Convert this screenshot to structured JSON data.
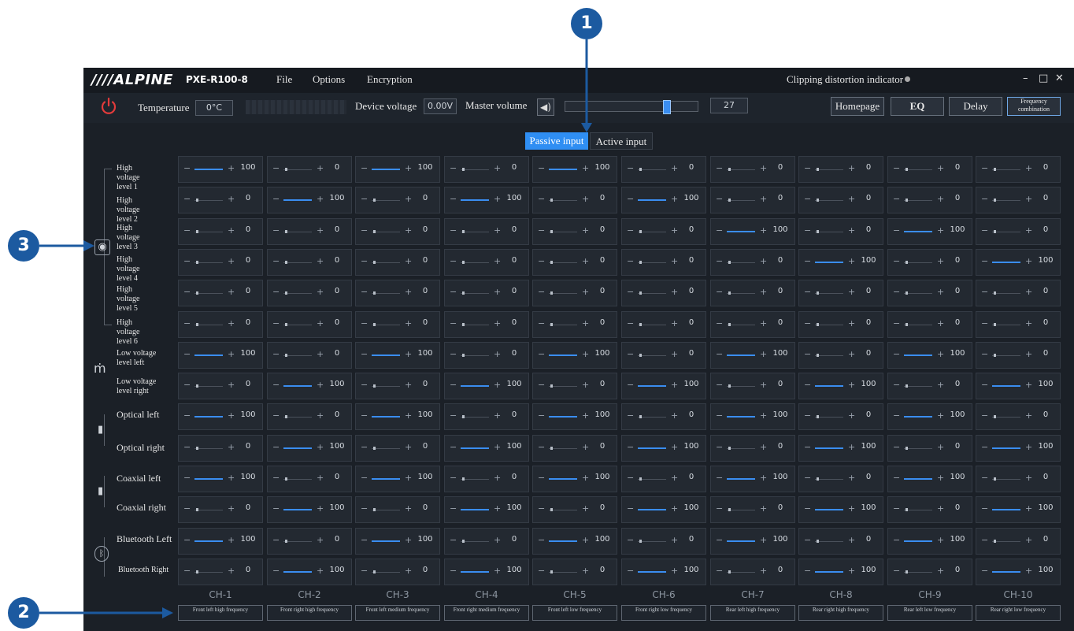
{
  "app": {
    "brand": "////ALPINE",
    "model": "PXE-R100-8",
    "menu": [
      "File",
      "Options",
      "Encryption"
    ],
    "clipping_indicator": "Clipping distortion indicator",
    "window_controls": [
      "–",
      "□",
      "✕"
    ]
  },
  "toolbar": {
    "temperature_label": "Temperature",
    "temperature_value": "0°C",
    "device_voltage_label": "Device voltage",
    "device_voltage_value": "0.00V",
    "master_volume_label": "Master volume",
    "master_volume_value": "27",
    "master_volume_fraction": 0.8,
    "nav": [
      "Homepage",
      "EQ",
      "Delay",
      "Frequency combination"
    ],
    "active_nav": "EQ"
  },
  "input_tabs": {
    "passive": "Passive input",
    "active": "Active input",
    "selected": "passive"
  },
  "rows": [
    {
      "label": "High voltage level 1",
      "values": [
        100,
        0,
        100,
        0,
        100,
        0,
        0,
        0,
        0,
        0
      ]
    },
    {
      "label": "High voltage level 2",
      "values": [
        0,
        100,
        0,
        100,
        0,
        100,
        0,
        0,
        0,
        0
      ]
    },
    {
      "label": "High voltage level 3",
      "values": [
        0,
        0,
        0,
        0,
        0,
        0,
        100,
        0,
        100,
        0
      ]
    },
    {
      "label": "High voltage level 4",
      "values": [
        0,
        0,
        0,
        0,
        0,
        0,
        0,
        100,
        0,
        100
      ]
    },
    {
      "label": "High voltage level 5",
      "values": [
        0,
        0,
        0,
        0,
        0,
        0,
        0,
        0,
        0,
        0
      ]
    },
    {
      "label": "High voltage level 6",
      "values": [
        0,
        0,
        0,
        0,
        0,
        0,
        0,
        0,
        0,
        0
      ]
    },
    {
      "label": "Low voltage level left",
      "values": [
        100,
        0,
        100,
        0,
        100,
        0,
        100,
        0,
        100,
        0
      ]
    },
    {
      "label": "Low voltage level right",
      "values": [
        0,
        100,
        0,
        100,
        0,
        100,
        0,
        100,
        0,
        100
      ]
    },
    {
      "label": "Optical left",
      "values": [
        100,
        0,
        100,
        0,
        100,
        0,
        100,
        0,
        100,
        0
      ]
    },
    {
      "label": "Optical right",
      "values": [
        0,
        100,
        0,
        100,
        0,
        100,
        0,
        100,
        0,
        100
      ]
    },
    {
      "label": "Coaxial left",
      "values": [
        100,
        0,
        100,
        0,
        100,
        0,
        100,
        0,
        100,
        0
      ]
    },
    {
      "label": "Coaxial right",
      "values": [
        0,
        100,
        0,
        100,
        0,
        100,
        0,
        100,
        0,
        100
      ]
    },
    {
      "label": "Bluetooth Left",
      "values": [
        100,
        0,
        100,
        0,
        100,
        0,
        100,
        0,
        100,
        0
      ]
    },
    {
      "label": "Bluetooth Right",
      "values": [
        0,
        100,
        0,
        100,
        0,
        100,
        0,
        100,
        0,
        100
      ]
    }
  ],
  "slider_signs": {
    "minus": "−",
    "plus": "+"
  },
  "channels": [
    {
      "name": "CH-1",
      "desc": "Front left high frequency"
    },
    {
      "name": "CH-2",
      "desc": "Front right high frequency"
    },
    {
      "name": "CH-3",
      "desc": "Front left medium frequency"
    },
    {
      "name": "CH-4",
      "desc": "Front right medium frequency"
    },
    {
      "name": "CH-5",
      "desc": "Front left low frequency"
    },
    {
      "name": "CH-6",
      "desc": "Front right low frequency"
    },
    {
      "name": "CH-7",
      "desc": "Rear left high frequency"
    },
    {
      "name": "CH-8",
      "desc": "Rear right high frequency"
    },
    {
      "name": "CH-9",
      "desc": "Rear left low frequency"
    },
    {
      "name": "CH-10",
      "desc": "Rear right low frequency"
    }
  ],
  "callouts": [
    "1",
    "2",
    "3"
  ],
  "colors": {
    "accent": "#2f8ef3",
    "background": "#1b2027",
    "callout": "#1c5aa0",
    "power": "#e23b3b"
  }
}
